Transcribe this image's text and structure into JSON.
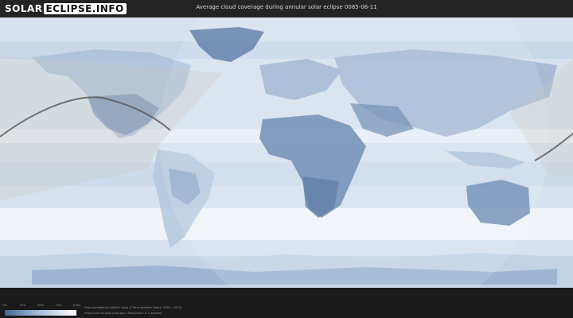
{
  "header": {
    "logo_part1": "SOLAR",
    "logo_part2": "ECLIPSE.INFO",
    "title": "Average cloud coverage during annular solar eclipse 0085-06-11"
  },
  "colors": {
    "background": "#1f1f1f",
    "map_clear": "#ffffff",
    "map_cloudy": "#3f6596",
    "eclipse_path": "#5a5a5a"
  },
  "legend": {
    "ticks": [
      "0%",
      "25%",
      "50%",
      "75%",
      "100%"
    ],
    "scale_from": "cloudy-dark-blue",
    "scale_to": "clear-white"
  },
  "credits": {
    "line1": "Data provided by NASA's Aqua & Terra satellite (Years: 2000 - 2019)",
    "line2": "https://neo.sci.gsfc.nasa.gov | Resolution: 0.1 degrees"
  }
}
